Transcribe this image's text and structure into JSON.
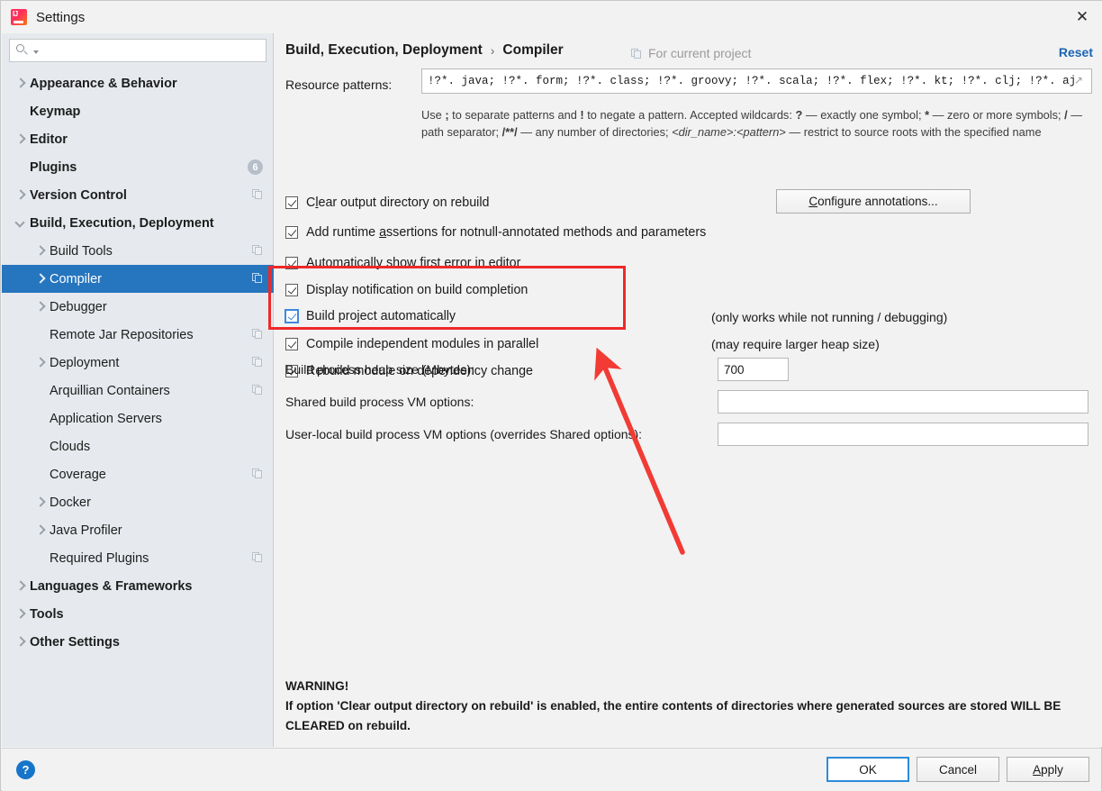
{
  "window": {
    "title": "Settings",
    "app_icon": "intellij-idea-icon",
    "close_icon": "close-icon"
  },
  "sidebar": {
    "search": {
      "value": "",
      "placeholder": "",
      "icon": "search-icon"
    },
    "items": [
      {
        "label": "Appearance & Behavior",
        "indent": 0,
        "twisty": "right",
        "bold": true
      },
      {
        "label": "Keymap",
        "indent": 0,
        "twisty": "none",
        "bold": true
      },
      {
        "label": "Editor",
        "indent": 0,
        "twisty": "right",
        "bold": true
      },
      {
        "label": "Plugins",
        "indent": 0,
        "twisty": "none",
        "bold": true,
        "badge": "6"
      },
      {
        "label": "Version Control",
        "indent": 0,
        "twisty": "right",
        "bold": true,
        "copy": true
      },
      {
        "label": "Build, Execution, Deployment",
        "indent": 0,
        "twisty": "down",
        "bold": true
      },
      {
        "label": "Build Tools",
        "indent": 1,
        "twisty": "right",
        "bold": false,
        "copy": true
      },
      {
        "label": "Compiler",
        "indent": 1,
        "twisty": "right",
        "bold": false,
        "copy": true,
        "selected": true
      },
      {
        "label": "Debugger",
        "indent": 1,
        "twisty": "right",
        "bold": false
      },
      {
        "label": "Remote Jar Repositories",
        "indent": 1,
        "twisty": "none",
        "bold": false,
        "copy": true
      },
      {
        "label": "Deployment",
        "indent": 1,
        "twisty": "right",
        "bold": false,
        "copy": true
      },
      {
        "label": "Arquillian Containers",
        "indent": 1,
        "twisty": "none",
        "bold": false,
        "copy": true
      },
      {
        "label": "Application Servers",
        "indent": 1,
        "twisty": "none",
        "bold": false
      },
      {
        "label": "Clouds",
        "indent": 1,
        "twisty": "none",
        "bold": false
      },
      {
        "label": "Coverage",
        "indent": 1,
        "twisty": "none",
        "bold": false,
        "copy": true
      },
      {
        "label": "Docker",
        "indent": 1,
        "twisty": "right",
        "bold": false
      },
      {
        "label": "Java Profiler",
        "indent": 1,
        "twisty": "right",
        "bold": false
      },
      {
        "label": "Required Plugins",
        "indent": 1,
        "twisty": "none",
        "bold": false,
        "copy": true
      },
      {
        "label": "Languages & Frameworks",
        "indent": 0,
        "twisty": "right",
        "bold": true
      },
      {
        "label": "Tools",
        "indent": 0,
        "twisty": "right",
        "bold": true
      },
      {
        "label": "Other Settings",
        "indent": 0,
        "twisty": "right",
        "bold": true
      }
    ]
  },
  "main": {
    "breadcrumb": {
      "root": "Build, Execution, Deployment",
      "separator": "›",
      "current": "Compiler"
    },
    "scope_note": {
      "text": "For current project",
      "icon": "project-scope-icon"
    },
    "reset_link": "Reset",
    "resource_patterns": {
      "label": "Resource patterns:",
      "value": "!?*. java; !?*. form; !?*. class; !?*. groovy; !?*. scala; !?*. flex; !?*. kt; !?*. clj; !?*. aj",
      "expand_icon": "expand-icon"
    },
    "hint": {
      "line1_a": "Use ",
      "line1_semicolon": ";",
      "line1_b": " to separate patterns and ",
      "line1_bang": "!",
      "line1_c": " to negate a pattern. Accepted wildcards: ",
      "line1_q": "?",
      "line1_d": " — exactly one symbol; ",
      "line1_star": "*",
      "line1_e": " — zero or more symbols; ",
      "line2_slash": "/",
      "line2_a": " — path separator; ",
      "line2_globs": "/**/",
      "line2_b": " — any number of directories; ",
      "line2_dirname": "<dir_name>:<pattern>",
      "line2_c": " — restrict to source roots with the specified name"
    },
    "checkboxes": [
      {
        "label": "Clear output directory on rebuild",
        "mnemonic_index": 1,
        "checked": true,
        "focused": false
      },
      {
        "label": "Add runtime assertions for notnull-annotated methods and parameters",
        "mnemonic_index": 12,
        "checked": true,
        "focused": false
      },
      {
        "label": "Automatically show first error in editor",
        "mnemonic_index": 29,
        "checked": true,
        "focused": false
      },
      {
        "label": "Display notification on build completion",
        "mnemonic_index": -1,
        "checked": true,
        "focused": false
      },
      {
        "label": "Build project automatically",
        "mnemonic_index": -1,
        "checked": true,
        "focused": true
      },
      {
        "label": "Compile independent modules in parallel",
        "mnemonic_index": -1,
        "checked": true,
        "focused": false
      },
      {
        "label": "Rebuild module on dependency change",
        "mnemonic_index": -1,
        "checked": true,
        "focused": false
      }
    ],
    "configure_annotations_button": {
      "label": "Configure annotations...",
      "mnemonic_index": 0
    },
    "side_notes": [
      "(only works while not running / debugging)",
      "(may require larger heap size)"
    ],
    "fields": [
      {
        "label": "Build process heap size (Mbytes):",
        "value": "700"
      },
      {
        "label": "Shared build process VM options:",
        "value": ""
      },
      {
        "label": "User-local build process VM options (overrides Shared options):",
        "value": ""
      }
    ],
    "warning": {
      "heading": "WARNING!",
      "body": "If option 'Clear output directory on rebuild' is enabled, the entire contents of directories where generated sources are stored WILL BE CLEARED on rebuild."
    }
  },
  "footer": {
    "help_icon": "help-icon",
    "help_label": "?",
    "buttons": [
      {
        "label": "OK",
        "default": true,
        "mnemonic_index": -1
      },
      {
        "label": "Cancel",
        "default": false,
        "mnemonic_index": -1
      },
      {
        "label": "Apply",
        "default": false,
        "mnemonic_index": 0
      }
    ]
  },
  "annotations": {
    "highlight_color": "#ef2929",
    "arrow_color": "#f13b34",
    "rect_label": "highlight-rectangle",
    "arrow_label": "pointer-arrow"
  }
}
